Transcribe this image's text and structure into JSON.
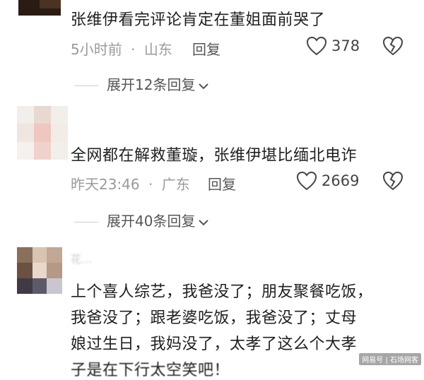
{
  "comments": [
    {
      "text": "张维伊看完评论肯定在董姐面前哭了",
      "time": "5小时前",
      "location": "山东",
      "reply_label": "回复",
      "likes": "378",
      "expand_label": "展开12条回复"
    },
    {
      "text": "全网都在解救董璇，张维伊堪比缅北电诈",
      "time": "昨天23:46",
      "location": "广东",
      "reply_label": "回复",
      "likes": "2669",
      "expand_label": "展开40条回复"
    },
    {
      "username": "花…",
      "text_lines": [
        "上个喜人综艺，我爸没了；朋友聚餐吃饭，",
        "我爸没了；跟老婆吃饭，我爸没了；丈母",
        "娘过生日，我妈没了，太孝了这么个大孝",
        "子是在下行太空笑吧！"
      ]
    }
  ],
  "meta_separator": "·",
  "watermark": "网易号 | 石场网客",
  "icons": [
    "heart-icon",
    "dislike-heart-icon",
    "chevron-down-icon"
  ],
  "colors": {
    "meta_gray": "#9a9a9a",
    "text": "#1f1f1f",
    "background": "#ffffff"
  }
}
